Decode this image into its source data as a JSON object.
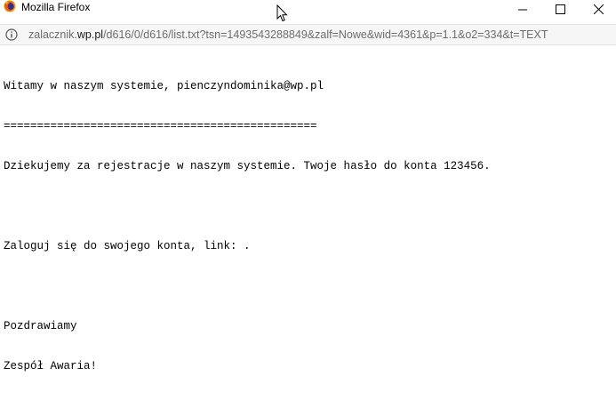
{
  "window": {
    "title": "Mozilla Firefox",
    "icon": "firefox-logo-icon",
    "controls": {
      "minimize": "minimize-icon",
      "maximize": "maximize-icon",
      "close": "close-icon"
    }
  },
  "urlbar": {
    "info_icon": "info-icon",
    "prefix": "zalacznik.",
    "host": "wp.pl",
    "path": "/d616/0/d616/list.txt?tsn=1493543288849&zalf=Nowe&wid=4361&p=1.1&o2=334&t=TEXT"
  },
  "document": {
    "greeting": "Witamy w naszym systemie, pienczyndominika@wp.pl",
    "separator": "===============================================",
    "thanks": "Dziekujemy za rejestracje w naszym systemie. Twoje hasło do konta 123456.",
    "blank1": "",
    "login": "Zaloguj się do swojego konta, link: .",
    "blank2": "",
    "regards": "Pozdrawiamy",
    "signature": "Zespół Awaria!"
  }
}
